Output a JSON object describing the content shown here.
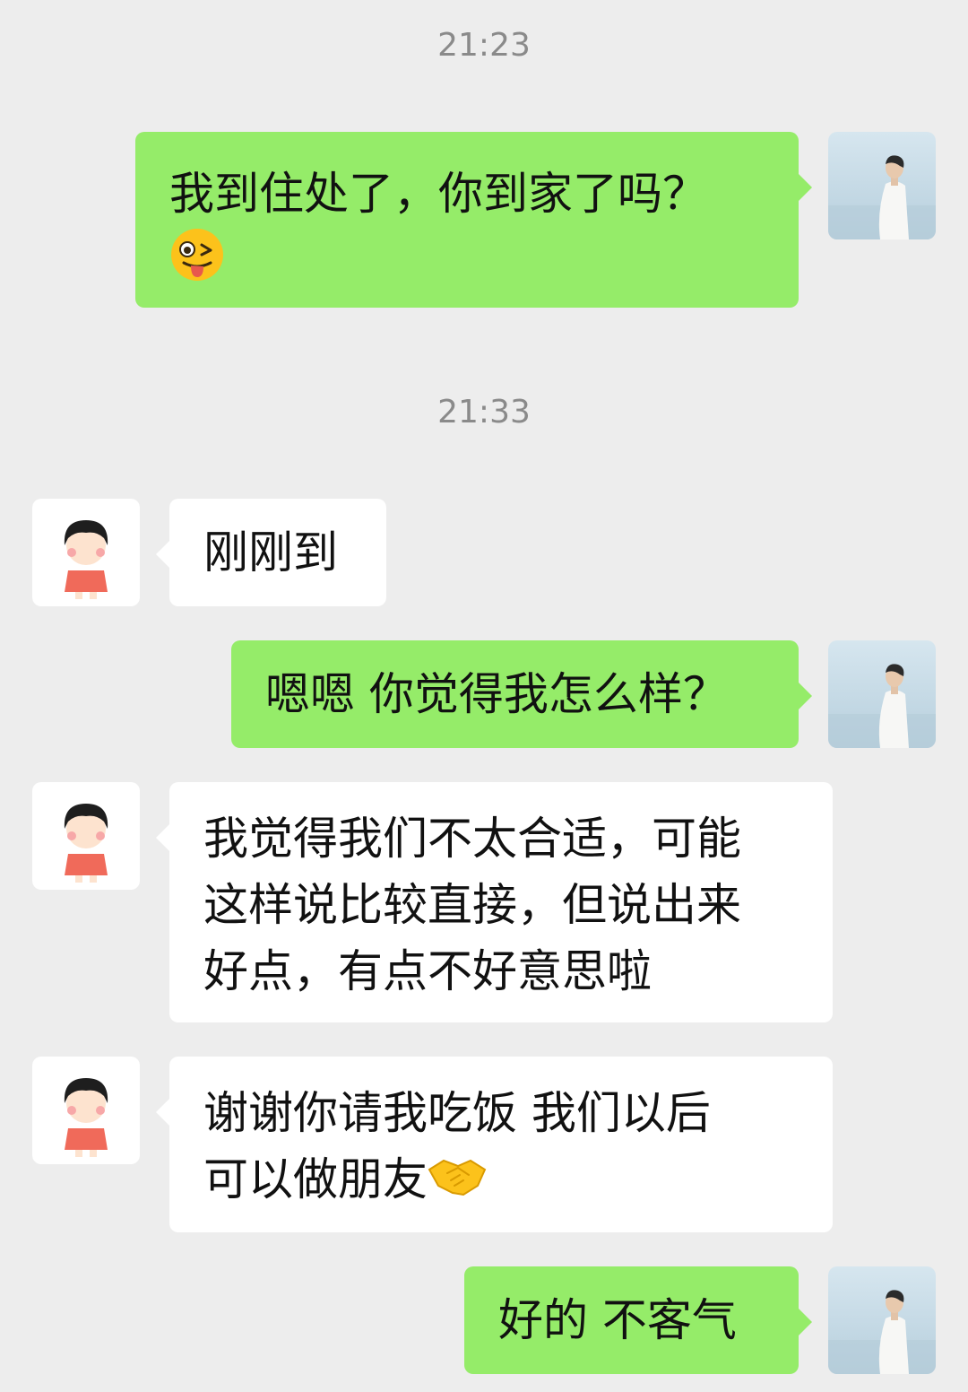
{
  "messages": [
    {
      "type": "timestamp",
      "text": "21:23"
    },
    {
      "type": "outgoing",
      "lines": [
        "我到住处了，你到家了吗？"
      ],
      "emoji": "winking-tongue-emoji"
    },
    {
      "type": "timestamp",
      "text": "21:33"
    },
    {
      "type": "incoming",
      "lines": [
        "刚刚到"
      ]
    },
    {
      "type": "outgoing",
      "lines": [
        "嗯嗯 你觉得我怎么样？"
      ]
    },
    {
      "type": "incoming",
      "lines": [
        "我觉得我们不太合适，可能",
        "这样说比较直接，但说出来",
        "好点，有点不好意思啦"
      ]
    },
    {
      "type": "incoming",
      "lines": [
        "谢谢你请我吃饭 我们以后",
        "可以做朋友"
      ],
      "emoji": "handshake-emoji"
    },
    {
      "type": "outgoing",
      "lines": [
        "好的 不客气"
      ]
    }
  ],
  "colors": {
    "background": "#ededed",
    "outgoing_bubble": "#95ec69",
    "incoming_bubble": "#ffffff",
    "timestamp_text": "#8a8a8a"
  }
}
